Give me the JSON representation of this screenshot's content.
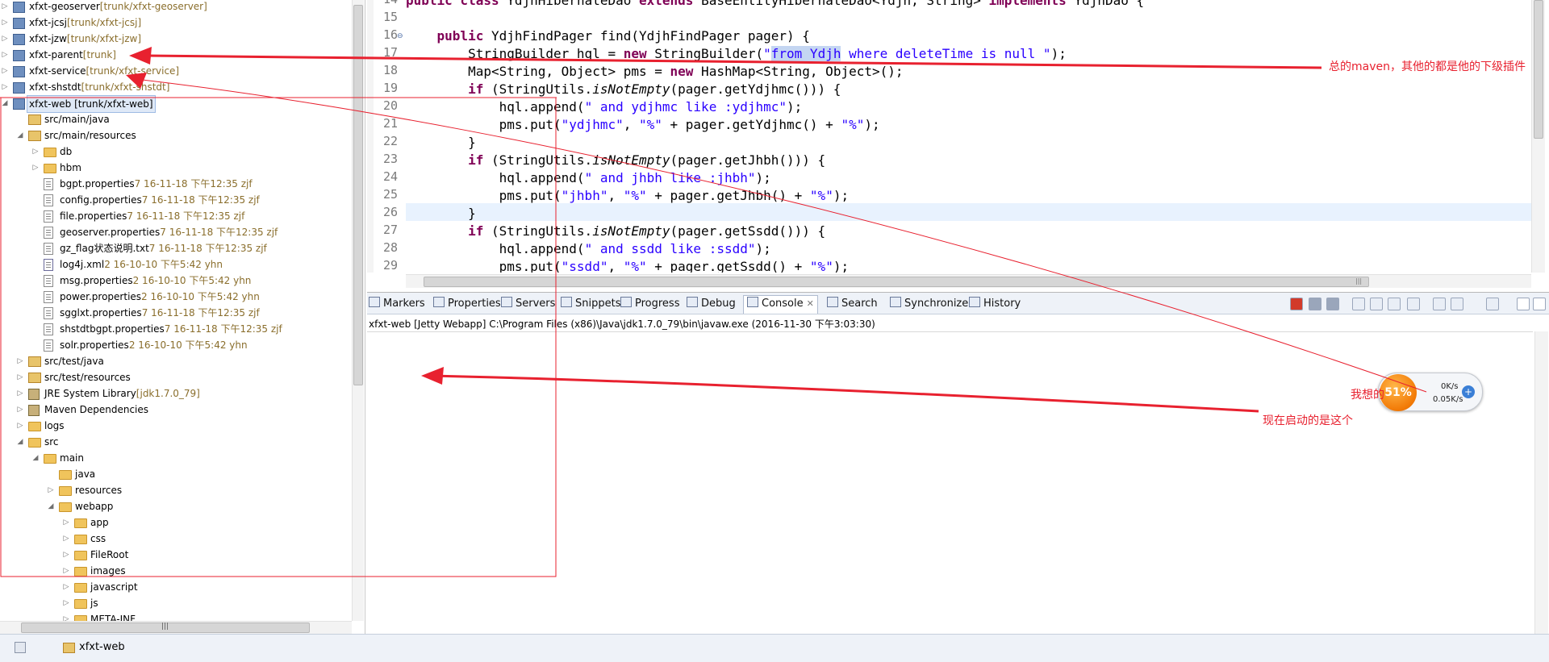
{
  "explorer": {
    "items": [
      {
        "depth": 0,
        "twisty": "collapsed",
        "icon": "project-icon",
        "label": "xfxt-geoserver",
        "dec": "[trunk/xfxt-geoserver]"
      },
      {
        "depth": 0,
        "twisty": "collapsed",
        "icon": "project-icon",
        "label": "xfxt-jcsj",
        "dec": "[trunk/xfxt-jcsj]"
      },
      {
        "depth": 0,
        "twisty": "collapsed",
        "icon": "project-icon",
        "label": "xfxt-jzw",
        "dec": "[trunk/xfxt-jzw]"
      },
      {
        "depth": 0,
        "twisty": "collapsed",
        "icon": "project-icon",
        "label": "xfxt-parent",
        "dec": "[trunk]"
      },
      {
        "depth": 0,
        "twisty": "collapsed",
        "icon": "project-icon",
        "label": "xfxt-service",
        "dec": "[trunk/xfxt-service]"
      },
      {
        "depth": 0,
        "twisty": "collapsed",
        "icon": "project-icon",
        "label": "xfxt-shstdt",
        "dec": "[trunk/xfxt-shstdt]"
      },
      {
        "depth": 0,
        "twisty": "expanded",
        "icon": "project-icon",
        "label": "xfxt-web [trunk/xfxt-web]",
        "dec": "",
        "selected": true
      },
      {
        "depth": 1,
        "twisty": "none",
        "icon": "source-folder-icon",
        "label": "src/main/java",
        "dec": ""
      },
      {
        "depth": 1,
        "twisty": "expanded",
        "icon": "source-folder-icon",
        "label": "src/main/resources",
        "dec": ""
      },
      {
        "depth": 2,
        "twisty": "collapsed",
        "icon": "folder-icon",
        "label": "db",
        "dec": ""
      },
      {
        "depth": 2,
        "twisty": "collapsed",
        "icon": "folder-icon",
        "label": "hbm",
        "dec": ""
      },
      {
        "depth": 2,
        "twisty": "none",
        "icon": "file-icon",
        "label": "bgpt.properties",
        "dec": "7  16-11-18 下午12:35  zjf"
      },
      {
        "depth": 2,
        "twisty": "none",
        "icon": "file-icon",
        "label": "config.properties",
        "dec": "7  16-11-18 下午12:35  zjf"
      },
      {
        "depth": 2,
        "twisty": "none",
        "icon": "file-icon",
        "label": "file.properties",
        "dec": "7  16-11-18 下午12:35  zjf"
      },
      {
        "depth": 2,
        "twisty": "none",
        "icon": "file-icon",
        "label": "geoserver.properties",
        "dec": "7  16-11-18 下午12:35  zjf"
      },
      {
        "depth": 2,
        "twisty": "none",
        "icon": "file-icon",
        "label": "gz_flag状态说明.txt",
        "dec": "7  16-11-18 下午12:35  zjf"
      },
      {
        "depth": 2,
        "twisty": "none",
        "icon": "xml-file-icon",
        "label": "log4j.xml",
        "dec": "2  16-10-10 下午5:42  yhn"
      },
      {
        "depth": 2,
        "twisty": "none",
        "icon": "file-icon",
        "label": "msg.properties",
        "dec": "2  16-10-10 下午5:42  yhn"
      },
      {
        "depth": 2,
        "twisty": "none",
        "icon": "file-icon",
        "label": "power.properties",
        "dec": "2  16-10-10 下午5:42  yhn"
      },
      {
        "depth": 2,
        "twisty": "none",
        "icon": "file-icon",
        "label": "sgglxt.properties",
        "dec": "7  16-11-18 下午12:35  zjf"
      },
      {
        "depth": 2,
        "twisty": "none",
        "icon": "file-icon",
        "label": "shstdtbgpt.properties",
        "dec": "7  16-11-18 下午12:35  zjf"
      },
      {
        "depth": 2,
        "twisty": "none",
        "icon": "file-icon",
        "label": "solr.properties",
        "dec": "2  16-10-10 下午5:42  yhn"
      },
      {
        "depth": 1,
        "twisty": "collapsed",
        "icon": "source-folder-icon",
        "label": "src/test/java",
        "dec": ""
      },
      {
        "depth": 1,
        "twisty": "collapsed",
        "icon": "source-folder-icon",
        "label": "src/test/resources",
        "dec": ""
      },
      {
        "depth": 1,
        "twisty": "collapsed",
        "icon": "library-icon",
        "label": "JRE System Library",
        "dec": "[jdk1.7.0_79]"
      },
      {
        "depth": 1,
        "twisty": "collapsed",
        "icon": "library-icon",
        "label": "Maven Dependencies",
        "dec": ""
      },
      {
        "depth": 1,
        "twisty": "collapsed",
        "icon": "folder-icon",
        "label": "logs",
        "dec": ""
      },
      {
        "depth": 1,
        "twisty": "expanded",
        "icon": "folder-icon",
        "label": "src",
        "dec": ""
      },
      {
        "depth": 2,
        "twisty": "expanded",
        "icon": "folder-icon",
        "label": "main",
        "dec": ""
      },
      {
        "depth": 3,
        "twisty": "none",
        "icon": "folder-icon",
        "label": "java",
        "dec": ""
      },
      {
        "depth": 3,
        "twisty": "collapsed",
        "icon": "folder-icon",
        "label": "resources",
        "dec": ""
      },
      {
        "depth": 3,
        "twisty": "expanded",
        "icon": "folder-icon",
        "label": "webapp",
        "dec": ""
      },
      {
        "depth": 4,
        "twisty": "collapsed",
        "icon": "folder-icon",
        "label": "app",
        "dec": ""
      },
      {
        "depth": 4,
        "twisty": "collapsed",
        "icon": "folder-icon",
        "label": "css",
        "dec": ""
      },
      {
        "depth": 4,
        "twisty": "collapsed",
        "icon": "folder-icon",
        "label": "FileRoot",
        "dec": ""
      },
      {
        "depth": 4,
        "twisty": "collapsed",
        "icon": "folder-icon",
        "label": "images",
        "dec": ""
      },
      {
        "depth": 4,
        "twisty": "collapsed",
        "icon": "folder-icon",
        "label": "javascript",
        "dec": ""
      },
      {
        "depth": 4,
        "twisty": "collapsed",
        "icon": "folder-icon",
        "label": "js",
        "dec": ""
      },
      {
        "depth": 4,
        "twisty": "collapsed",
        "icon": "folder-icon",
        "label": "META-INF",
        "dec": ""
      }
    ]
  },
  "editor": {
    "lines": [
      {
        "num": "14",
        "text": "public class YdjhHibernateDao extends BaseEntityHibernateDao<Ydjh, String> implements YdjhDao {"
      },
      {
        "num": "15",
        "text": ""
      },
      {
        "num": "16",
        "text": "    public YdjhFindPager find(YdjhFindPager pager) {"
      },
      {
        "num": "17",
        "text": "        StringBuilder hql = new StringBuilder(\"from Ydjh where deleteTime is null \");"
      },
      {
        "num": "18",
        "text": "        Map<String, Object> pms = new HashMap<String, Object>();"
      },
      {
        "num": "19",
        "text": "        if (StringUtils.isNotEmpty(pager.getYdjhmc())) {"
      },
      {
        "num": "20",
        "text": "            hql.append(\" and ydjhmc like :ydjhmc\");"
      },
      {
        "num": "21",
        "text": "            pms.put(\"ydjhmc\", \"%\" + pager.getYdjhmc() + \"%\");"
      },
      {
        "num": "22",
        "text": "        }"
      },
      {
        "num": "23",
        "text": "        if (StringUtils.isNotEmpty(pager.getJhbh())) {"
      },
      {
        "num": "24",
        "text": "            hql.append(\" and jhbh like :jhbh\");"
      },
      {
        "num": "25",
        "text": "            pms.put(\"jhbh\", \"%\" + pager.getJhbh() + \"%\");"
      },
      {
        "num": "26",
        "text": "        }"
      },
      {
        "num": "27",
        "text": "        if (StringUtils.isNotEmpty(pager.getSsdd())) {"
      },
      {
        "num": "28",
        "text": "            hql.append(\" and ssdd like :ssdd\");"
      },
      {
        "num": "29",
        "text": "            pms.put(\"ssdd\", \"%\" + pager.getSsdd() + \"%\");"
      }
    ]
  },
  "console": {
    "tabs": [
      {
        "name": "markers",
        "label": "Markers"
      },
      {
        "name": "properties",
        "label": "Properties"
      },
      {
        "name": "servers",
        "label": "Servers"
      },
      {
        "name": "snippets",
        "label": "Snippets"
      },
      {
        "name": "progress",
        "label": "Progress"
      },
      {
        "name": "debug",
        "label": "Debug"
      },
      {
        "name": "console",
        "label": "Console",
        "active": true
      },
      {
        "name": "search",
        "label": "Search"
      },
      {
        "name": "synchronize",
        "label": "Synchronize"
      },
      {
        "name": "history",
        "label": "History"
      }
    ],
    "close_glyph": "✕",
    "status": "xfxt-web [Jetty Webapp] C:\\Program Files (x86)\\Java\\jdk1.7.0_79\\bin\\javaw.exe (2016-11-30 下午3:03:30)"
  },
  "statusbar": {
    "project": "xfxt-web"
  },
  "annotations": {
    "note_parent": "总的maven，其他的都是他的下级插件",
    "note_want": "我想的",
    "note_current": "现在启动的是这个",
    "color": "#e8212f"
  },
  "netwidget": {
    "percent": "51%",
    "up": "0K/s",
    "down": "0.05K/s",
    "plus": "+"
  }
}
